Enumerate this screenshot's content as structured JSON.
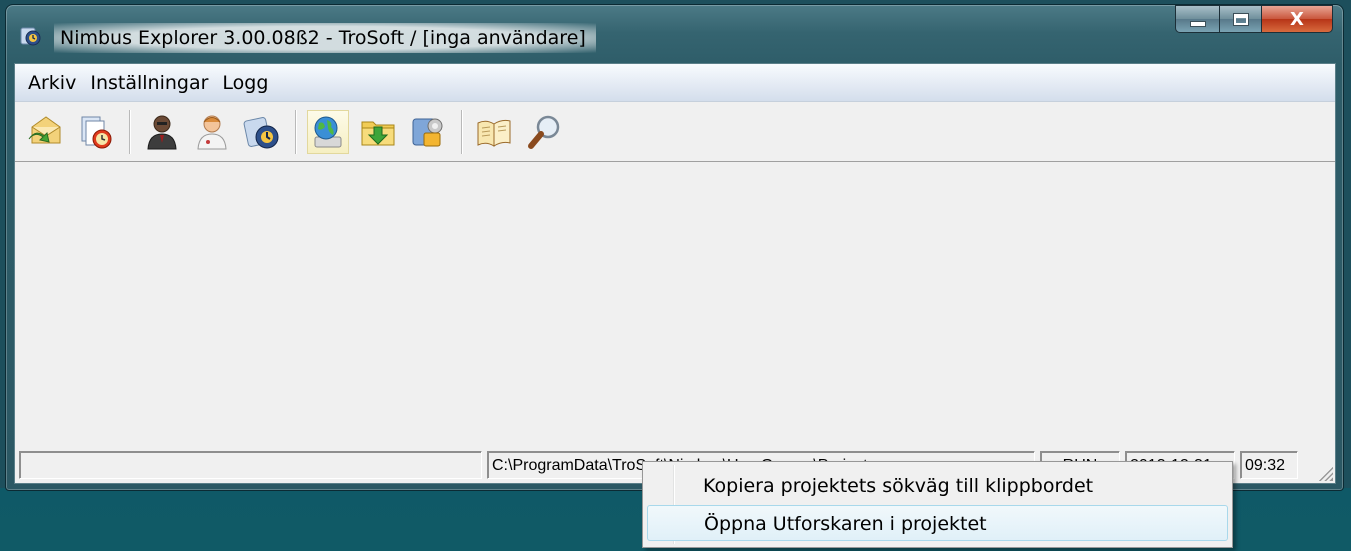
{
  "window": {
    "title": "Nimbus Explorer 3.00.08ß2 - TroSoft / [inga användare]",
    "close_glyph": "X"
  },
  "menubar": {
    "items": [
      {
        "label": "Arkiv"
      },
      {
        "label": "Inställningar"
      },
      {
        "label": "Logg"
      }
    ]
  },
  "toolbar": {
    "buttons": [
      {
        "icon": "mail-refresh-icon"
      },
      {
        "icon": "document-clock-icon"
      },
      {
        "icon": "user-dark-icon"
      },
      {
        "icon": "user-doctor-icon"
      },
      {
        "icon": "app-logo-icon"
      },
      {
        "icon": "globe-computer-icon",
        "active": true
      },
      {
        "icon": "folder-download-icon"
      },
      {
        "icon": "settings-key-icon"
      },
      {
        "icon": "book-icon"
      },
      {
        "icon": "magnifier-icon"
      }
    ]
  },
  "statusbar": {
    "panel_left": "",
    "path": "C:\\ProgramData\\TroSoft\\Nimbus\\UserGroups\\Project",
    "status": "RUN",
    "date": "2013-12-31",
    "time": "09:32"
  },
  "context_menu": {
    "items": [
      {
        "label": "Kopiera projektets sökväg till klippbordet"
      },
      {
        "label": "Öppna Utforskaren i projektet",
        "highlighted": true
      }
    ]
  },
  "colors": {
    "desktop": "#105a66",
    "window_frame": "#2e5d69",
    "client_bg": "#f0f0f0",
    "menu_highlight": "#e0f0f8",
    "close_button": "#c9563c"
  }
}
